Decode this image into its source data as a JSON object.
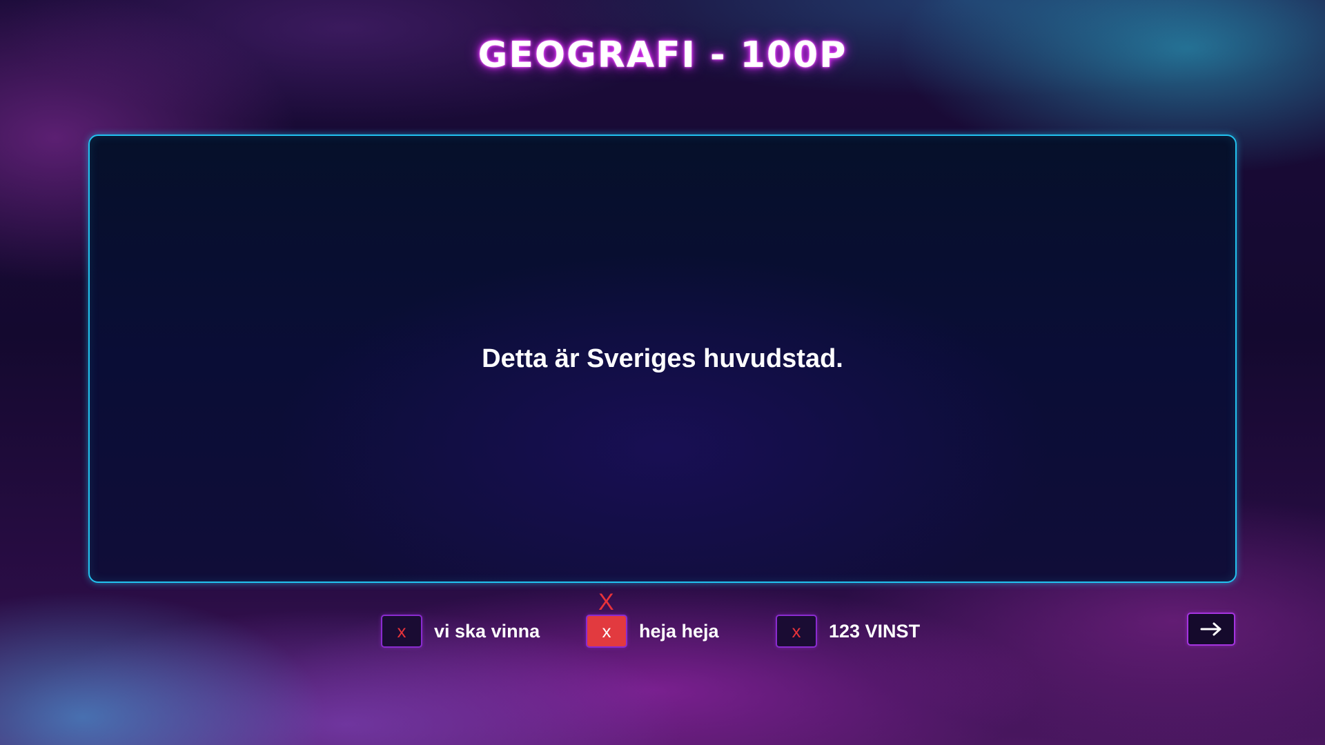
{
  "header": {
    "title": "GEOGRAFI - 100P"
  },
  "question": {
    "text": "Detta är Sveriges huvudstad."
  },
  "teams": [
    {
      "toggle_label": "x",
      "name": "vi ska vinna",
      "active": false
    },
    {
      "toggle_label": "x",
      "name": "heja heja",
      "active": true,
      "strike_label": "X"
    },
    {
      "toggle_label": "x",
      "name": "123 VINST",
      "active": false
    }
  ],
  "navigation": {
    "next_icon": "arrow-right-icon"
  },
  "colors": {
    "panel_border": "#22c3f0",
    "title_glow": "#e040fb",
    "active_toggle": "#e23a3f",
    "toggle_border": "#8a2bd0"
  }
}
